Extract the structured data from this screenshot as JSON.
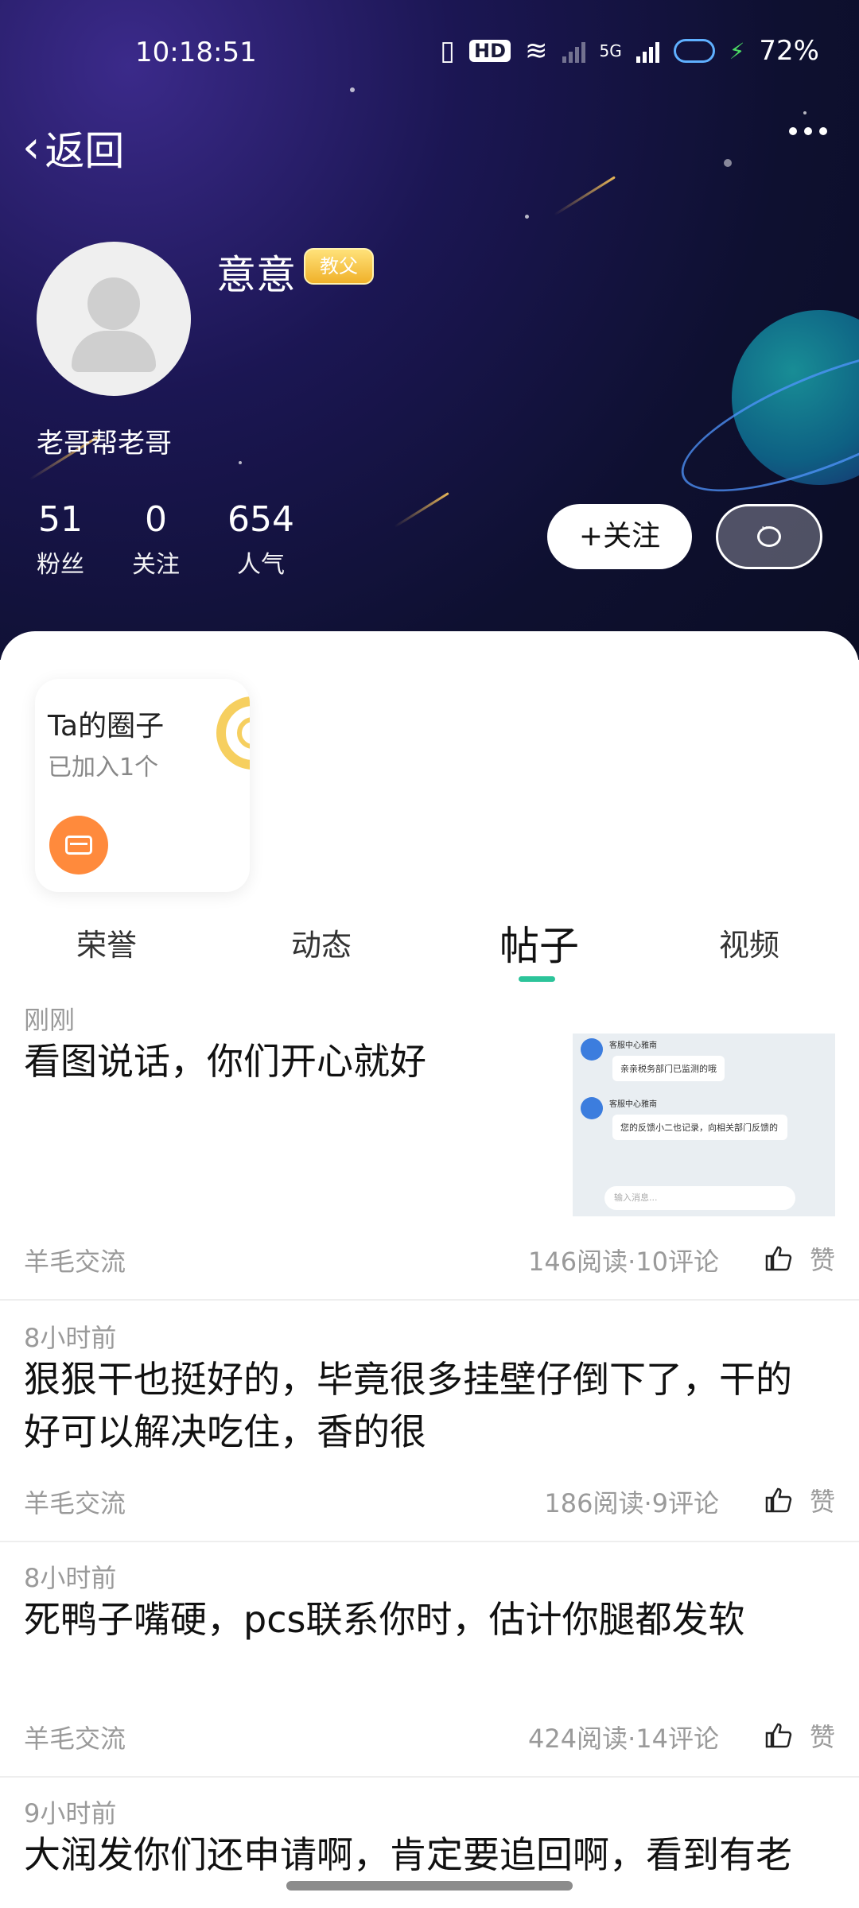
{
  "status_bar": {
    "time": "10:18:51",
    "hd": "HD",
    "network": "5G",
    "battery": "72%"
  },
  "nav": {
    "back_label": "返回"
  },
  "profile": {
    "name": "意意",
    "badge": "教父",
    "bio": "老哥帮老哥",
    "stats": [
      {
        "value": "51",
        "label": "粉丝"
      },
      {
        "value": "0",
        "label": "关注"
      },
      {
        "value": "654",
        "label": "人气"
      }
    ],
    "follow_label": "+关注"
  },
  "circle_card": {
    "title": "Ta的圈子",
    "subtitle": "已加入1个"
  },
  "tabs": [
    {
      "label": "荣誉"
    },
    {
      "label": "动态"
    },
    {
      "label": "帖子",
      "active": true
    },
    {
      "label": "视频"
    }
  ],
  "posts": [
    {
      "time": "刚刚",
      "title": "看图说话，你们开心就好",
      "tag": "羊毛交流",
      "meta": "146阅读·10评论",
      "like_label": "赞",
      "image": {
        "sender": "客服中心雅南",
        "msg1": "亲亲税务部门已监测的哦",
        "msg2": "您的反馈小二也记录，向相关部门反馈的",
        "input_placeholder": "输入消息..."
      }
    },
    {
      "time": "8小时前",
      "title_line1": "狠狠干也挺好的，毕竟很多挂壁仔倒下了，干的",
      "title_line2": "好可以解决吃住，香的很",
      "tag": "羊毛交流",
      "meta": "186阅读·9评论",
      "like_label": "赞"
    },
    {
      "time": "8小时前",
      "title": "死鸭子嘴硬，pcs联系你时，估计你腿都发软",
      "tag": "羊毛交流",
      "meta": "424阅读·14评论",
      "like_label": "赞"
    },
    {
      "time": "9小时前",
      "title": "大润发你们还申请啊，肯定要追回啊，看到有老"
    }
  ]
}
